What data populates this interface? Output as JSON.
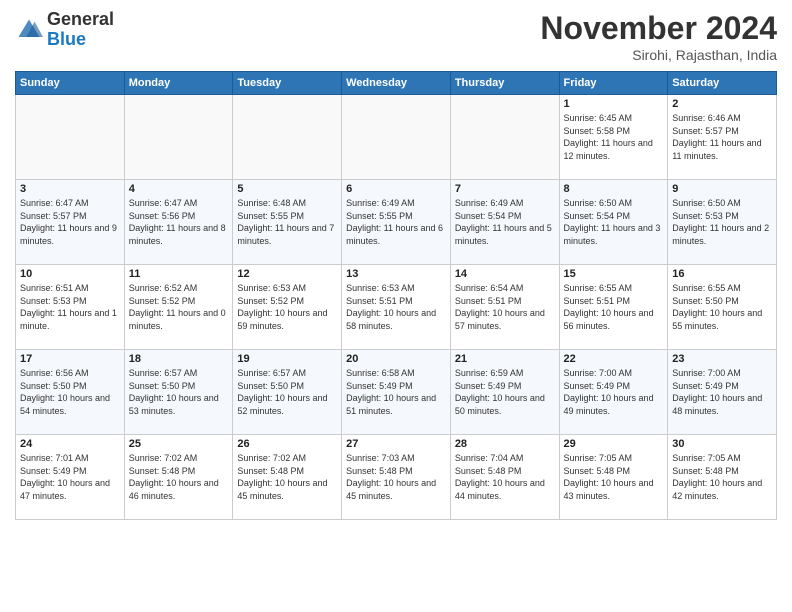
{
  "header": {
    "logo_general": "General",
    "logo_blue": "Blue",
    "month_title": "November 2024",
    "location": "Sirohi, Rajasthan, India"
  },
  "weekdays": [
    "Sunday",
    "Monday",
    "Tuesday",
    "Wednesday",
    "Thursday",
    "Friday",
    "Saturday"
  ],
  "weeks": [
    [
      {
        "day": "",
        "info": ""
      },
      {
        "day": "",
        "info": ""
      },
      {
        "day": "",
        "info": ""
      },
      {
        "day": "",
        "info": ""
      },
      {
        "day": "",
        "info": ""
      },
      {
        "day": "1",
        "info": "Sunrise: 6:45 AM\nSunset: 5:58 PM\nDaylight: 11 hours and 12 minutes."
      },
      {
        "day": "2",
        "info": "Sunrise: 6:46 AM\nSunset: 5:57 PM\nDaylight: 11 hours and 11 minutes."
      }
    ],
    [
      {
        "day": "3",
        "info": "Sunrise: 6:47 AM\nSunset: 5:57 PM\nDaylight: 11 hours and 9 minutes."
      },
      {
        "day": "4",
        "info": "Sunrise: 6:47 AM\nSunset: 5:56 PM\nDaylight: 11 hours and 8 minutes."
      },
      {
        "day": "5",
        "info": "Sunrise: 6:48 AM\nSunset: 5:55 PM\nDaylight: 11 hours and 7 minutes."
      },
      {
        "day": "6",
        "info": "Sunrise: 6:49 AM\nSunset: 5:55 PM\nDaylight: 11 hours and 6 minutes."
      },
      {
        "day": "7",
        "info": "Sunrise: 6:49 AM\nSunset: 5:54 PM\nDaylight: 11 hours and 5 minutes."
      },
      {
        "day": "8",
        "info": "Sunrise: 6:50 AM\nSunset: 5:54 PM\nDaylight: 11 hours and 3 minutes."
      },
      {
        "day": "9",
        "info": "Sunrise: 6:50 AM\nSunset: 5:53 PM\nDaylight: 11 hours and 2 minutes."
      }
    ],
    [
      {
        "day": "10",
        "info": "Sunrise: 6:51 AM\nSunset: 5:53 PM\nDaylight: 11 hours and 1 minute."
      },
      {
        "day": "11",
        "info": "Sunrise: 6:52 AM\nSunset: 5:52 PM\nDaylight: 11 hours and 0 minutes."
      },
      {
        "day": "12",
        "info": "Sunrise: 6:53 AM\nSunset: 5:52 PM\nDaylight: 10 hours and 59 minutes."
      },
      {
        "day": "13",
        "info": "Sunrise: 6:53 AM\nSunset: 5:51 PM\nDaylight: 10 hours and 58 minutes."
      },
      {
        "day": "14",
        "info": "Sunrise: 6:54 AM\nSunset: 5:51 PM\nDaylight: 10 hours and 57 minutes."
      },
      {
        "day": "15",
        "info": "Sunrise: 6:55 AM\nSunset: 5:51 PM\nDaylight: 10 hours and 56 minutes."
      },
      {
        "day": "16",
        "info": "Sunrise: 6:55 AM\nSunset: 5:50 PM\nDaylight: 10 hours and 55 minutes."
      }
    ],
    [
      {
        "day": "17",
        "info": "Sunrise: 6:56 AM\nSunset: 5:50 PM\nDaylight: 10 hours and 54 minutes."
      },
      {
        "day": "18",
        "info": "Sunrise: 6:57 AM\nSunset: 5:50 PM\nDaylight: 10 hours and 53 minutes."
      },
      {
        "day": "19",
        "info": "Sunrise: 6:57 AM\nSunset: 5:50 PM\nDaylight: 10 hours and 52 minutes."
      },
      {
        "day": "20",
        "info": "Sunrise: 6:58 AM\nSunset: 5:49 PM\nDaylight: 10 hours and 51 minutes."
      },
      {
        "day": "21",
        "info": "Sunrise: 6:59 AM\nSunset: 5:49 PM\nDaylight: 10 hours and 50 minutes."
      },
      {
        "day": "22",
        "info": "Sunrise: 7:00 AM\nSunset: 5:49 PM\nDaylight: 10 hours and 49 minutes."
      },
      {
        "day": "23",
        "info": "Sunrise: 7:00 AM\nSunset: 5:49 PM\nDaylight: 10 hours and 48 minutes."
      }
    ],
    [
      {
        "day": "24",
        "info": "Sunrise: 7:01 AM\nSunset: 5:49 PM\nDaylight: 10 hours and 47 minutes."
      },
      {
        "day": "25",
        "info": "Sunrise: 7:02 AM\nSunset: 5:48 PM\nDaylight: 10 hours and 46 minutes."
      },
      {
        "day": "26",
        "info": "Sunrise: 7:02 AM\nSunset: 5:48 PM\nDaylight: 10 hours and 45 minutes."
      },
      {
        "day": "27",
        "info": "Sunrise: 7:03 AM\nSunset: 5:48 PM\nDaylight: 10 hours and 45 minutes."
      },
      {
        "day": "28",
        "info": "Sunrise: 7:04 AM\nSunset: 5:48 PM\nDaylight: 10 hours and 44 minutes."
      },
      {
        "day": "29",
        "info": "Sunrise: 7:05 AM\nSunset: 5:48 PM\nDaylight: 10 hours and 43 minutes."
      },
      {
        "day": "30",
        "info": "Sunrise: 7:05 AM\nSunset: 5:48 PM\nDaylight: 10 hours and 42 minutes."
      }
    ]
  ]
}
